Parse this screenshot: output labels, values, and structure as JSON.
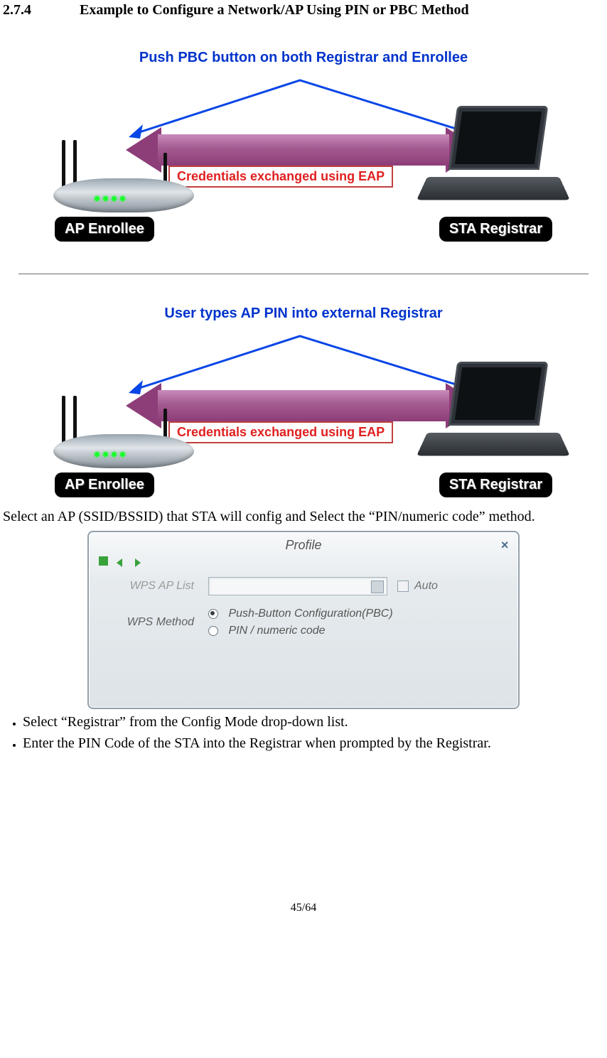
{
  "heading": {
    "number": "2.7.4",
    "title": "Example to Configure a Network/AP Using PIN or PBC Method"
  },
  "diagram1": {
    "title": "Push PBC button on both Registrar and Enrollee",
    "credential_text": "Credentials exchanged using EAP",
    "left_role": "AP Enrollee",
    "right_role": "STA Registrar"
  },
  "diagram2": {
    "title": "User types AP PIN into external Registrar",
    "credential_text": "Credentials exchanged using EAP",
    "left_role": "AP Enrollee",
    "right_role": "STA Registrar"
  },
  "paragraph1": "Select an AP (SSID/BSSID) that STA will config and Select the “PIN/numeric code” method.",
  "dialog": {
    "title": "Profile",
    "wps_ap_list_label": "WPS AP List",
    "auto_label": "Auto",
    "wps_method_label": "WPS Method",
    "option_pbc": "Push-Button Configuration(PBC)",
    "option_pin": "PIN / numeric code"
  },
  "bullets": [
    "Select “Registrar” from the Config Mode drop-down list.",
    "Enter the PIN Code of the STA into the Registrar when prompted by the Registrar."
  ],
  "page_number": "45/64"
}
